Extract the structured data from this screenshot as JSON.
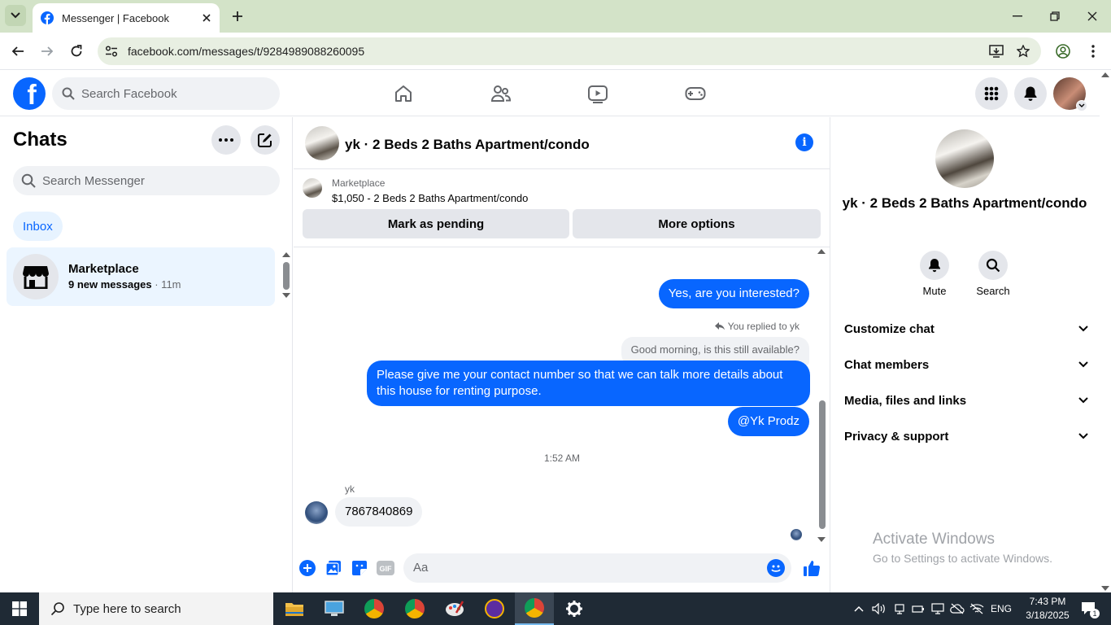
{
  "browser": {
    "tab_title": "Messenger | Facebook",
    "url": "facebook.com/messages/t/9284989088260095"
  },
  "facebook": {
    "logo_letter": "f",
    "search_placeholder": "Search Facebook"
  },
  "left": {
    "title": "Chats",
    "search_placeholder": "Search Messenger",
    "inbox_label": "Inbox",
    "chat": {
      "name": "Marketplace",
      "new_messages": "9 new messages",
      "time": " · 11m"
    }
  },
  "conversation": {
    "title": "yk · 2 Beds 2 Baths Apartment/condo",
    "marketplace_label": "Marketplace",
    "listing": "$1,050 - 2 Beds 2 Baths Apartment/condo",
    "mark_pending": "Mark as pending",
    "more_options": "More options",
    "messages": {
      "out1": "Yes, are you interested?",
      "reply_label": "You replied to yk",
      "quoted": "Good morning, is this still available?",
      "out2": "Please give me your contact number so that we can talk more details about this house for renting purpose.",
      "out3": "@Yk Prodz",
      "timestamp": "1:52 AM",
      "sender": "yk",
      "in1": "7867840869"
    },
    "composer_placeholder": "Aa"
  },
  "right": {
    "name": "yk · 2 Beds 2 Baths Apartment/condo",
    "mute": "Mute",
    "search": "Search",
    "sections": [
      "Customize chat",
      "Chat members",
      "Media, files and links",
      "Privacy & support"
    ]
  },
  "watermark": {
    "line1": "Activate Windows",
    "line2": "Go to Settings to activate Windows."
  },
  "taskbar": {
    "search_placeholder": "Type here to search",
    "language": "ENG",
    "time": "7:43 PM",
    "date": "3/18/2025",
    "notification_count": "1"
  },
  "colors": {
    "facebook_blue": "#0866ff",
    "chrome_tabbar": "#d3e3c8",
    "taskbar": "#1f2a35"
  }
}
